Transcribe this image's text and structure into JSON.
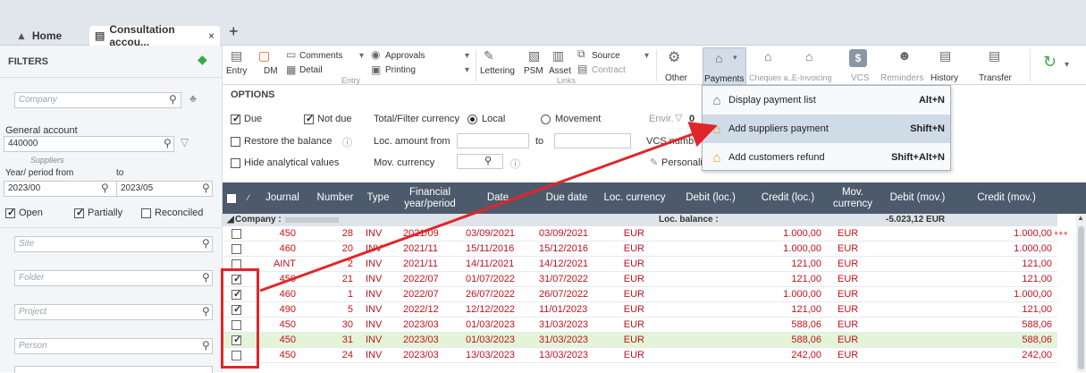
{
  "tabs": {
    "home": "Home",
    "consult": "Consultation accou...",
    "close": "×",
    "plus": "+"
  },
  "toolbar": {
    "entry": "Entry",
    "dm": "DM",
    "comments": "Comments",
    "detail": "Detail",
    "approvals": "Approvals",
    "printing": "Printing",
    "lettering": "Lettering",
    "psm": "PSM",
    "asset": "Asset",
    "source": "Source",
    "contract": "Contract",
    "other": "Other",
    "payments": "Payments",
    "cheques": "Cheques a...",
    "einvoicing": "E-Invoicing",
    "vcs": "VCS",
    "reminders": "Reminders",
    "history": "History",
    "transfer": "Transfer",
    "group_entry": "Entry",
    "group_links": "Links"
  },
  "sidebar": {
    "title": "FILTERS",
    "company_ph": "Company",
    "general_account_label": "General account",
    "general_account_value": "440000",
    "suppliers": "Suppliers",
    "period_from_label": "Year/ period from",
    "period_to_label": "to",
    "period_from": "2023/00",
    "period_to": "2023/05",
    "open": "Open",
    "partially": "Partially",
    "reconciled": "Reconciled",
    "site_ph": "Site",
    "folder_ph": "Folder",
    "project_ph": "Project",
    "person_ph": "Person"
  },
  "options": {
    "title": "OPTIONS",
    "due": "Due",
    "not_due": "Not due",
    "total_filter_currency": "Total/Filter currency",
    "local": "Local",
    "movement": "Movement",
    "envir": "Envir.",
    "envir_val": "0",
    "restore": "Restore the balance",
    "loc_amount_from": "Loc. amount from",
    "to": "to",
    "vcs_number": "VCS numb",
    "hide_analytical": "Hide analytical values",
    "mov_currency": "Mov. currency",
    "personaliz": "Personaliz"
  },
  "menu": [
    {
      "label": "Display payment list",
      "shortcut": "Alt+N"
    },
    {
      "label": "Add suppliers payment",
      "shortcut": "Shift+N"
    },
    {
      "label": "Add customers refund",
      "shortcut": "Shift+Alt+N"
    }
  ],
  "grid": {
    "headers": [
      "Journal",
      "Number",
      "Type",
      "Financial year/period",
      "Date",
      "Due date",
      "Loc. currency",
      "Debit (loc.)",
      "Credit (loc.)",
      "Mov. currency",
      "Debit (mov.)",
      "Credit (mov.)"
    ],
    "group_label": "Company :",
    "loc_balance_label": "Loc. balance :",
    "group_total": "-5.023,12 EUR",
    "rows": [
      {
        "checked": false,
        "green": false,
        "journal": "450",
        "number": "28",
        "type": "INV",
        "period": "2021/09",
        "date": "03/09/2021",
        "due": "03/09/2021",
        "cur": "EUR",
        "credit": "1.000,00",
        "mcur": "EUR",
        "mcredit": "1.000,00",
        "extra": "+++"
      },
      {
        "checked": false,
        "green": false,
        "journal": "460",
        "number": "20",
        "type": "INV",
        "period": "2021/11",
        "date": "15/11/2016",
        "due": "15/12/2016",
        "cur": "EUR",
        "credit": "1.000,00",
        "mcur": "EUR",
        "mcredit": "1.000,00",
        "extra": ""
      },
      {
        "checked": false,
        "green": false,
        "journal": "AINT",
        "number": "2",
        "type": "INV",
        "period": "2021/11",
        "date": "14/11/2021",
        "due": "14/12/2021",
        "cur": "EUR",
        "credit": "121,00",
        "mcur": "EUR",
        "mcredit": "121,00",
        "extra": ""
      },
      {
        "checked": true,
        "green": false,
        "journal": "450",
        "number": "21",
        "type": "INV",
        "period": "2022/07",
        "date": "01/07/2022",
        "due": "31/07/2022",
        "cur": "EUR",
        "credit": "121,00",
        "mcur": "EUR",
        "mcredit": "121,00",
        "extra": ""
      },
      {
        "checked": true,
        "green": false,
        "journal": "460",
        "number": "1",
        "type": "INV",
        "period": "2022/07",
        "date": "26/07/2022",
        "due": "26/07/2022",
        "cur": "EUR",
        "credit": "1.000,00",
        "mcur": "EUR",
        "mcredit": "1.000,00",
        "extra": ""
      },
      {
        "checked": true,
        "green": false,
        "journal": "490",
        "number": "5",
        "type": "INV",
        "period": "2022/12",
        "date": "12/12/2022",
        "due": "11/01/2023",
        "cur": "EUR",
        "credit": "121,00",
        "mcur": "EUR",
        "mcredit": "121,00",
        "extra": ""
      },
      {
        "checked": false,
        "green": false,
        "journal": "450",
        "number": "30",
        "type": "INV",
        "period": "2023/03",
        "date": "01/03/2023",
        "due": "31/03/2023",
        "cur": "EUR",
        "credit": "588,06",
        "mcur": "EUR",
        "mcredit": "588,06",
        "extra": ""
      },
      {
        "checked": true,
        "green": true,
        "journal": "450",
        "number": "31",
        "type": "INV",
        "period": "2023/03",
        "date": "01/03/2023",
        "due": "31/03/2023",
        "cur": "EUR",
        "credit": "588,06",
        "mcur": "EUR",
        "mcredit": "588,06",
        "extra": ""
      },
      {
        "checked": false,
        "green": false,
        "journal": "450",
        "number": "24",
        "type": "INV",
        "period": "2023/03",
        "date": "13/03/2023",
        "due": "13/03/2023",
        "cur": "EUR",
        "credit": "242,00",
        "mcur": "EUR",
        "mcredit": "242,00",
        "extra": ""
      }
    ]
  },
  "colors": {
    "header": "#4c5a6c",
    "row_text": "#c0141d",
    "highlight": "#e0262a",
    "green_row": "#e3f4d8"
  }
}
